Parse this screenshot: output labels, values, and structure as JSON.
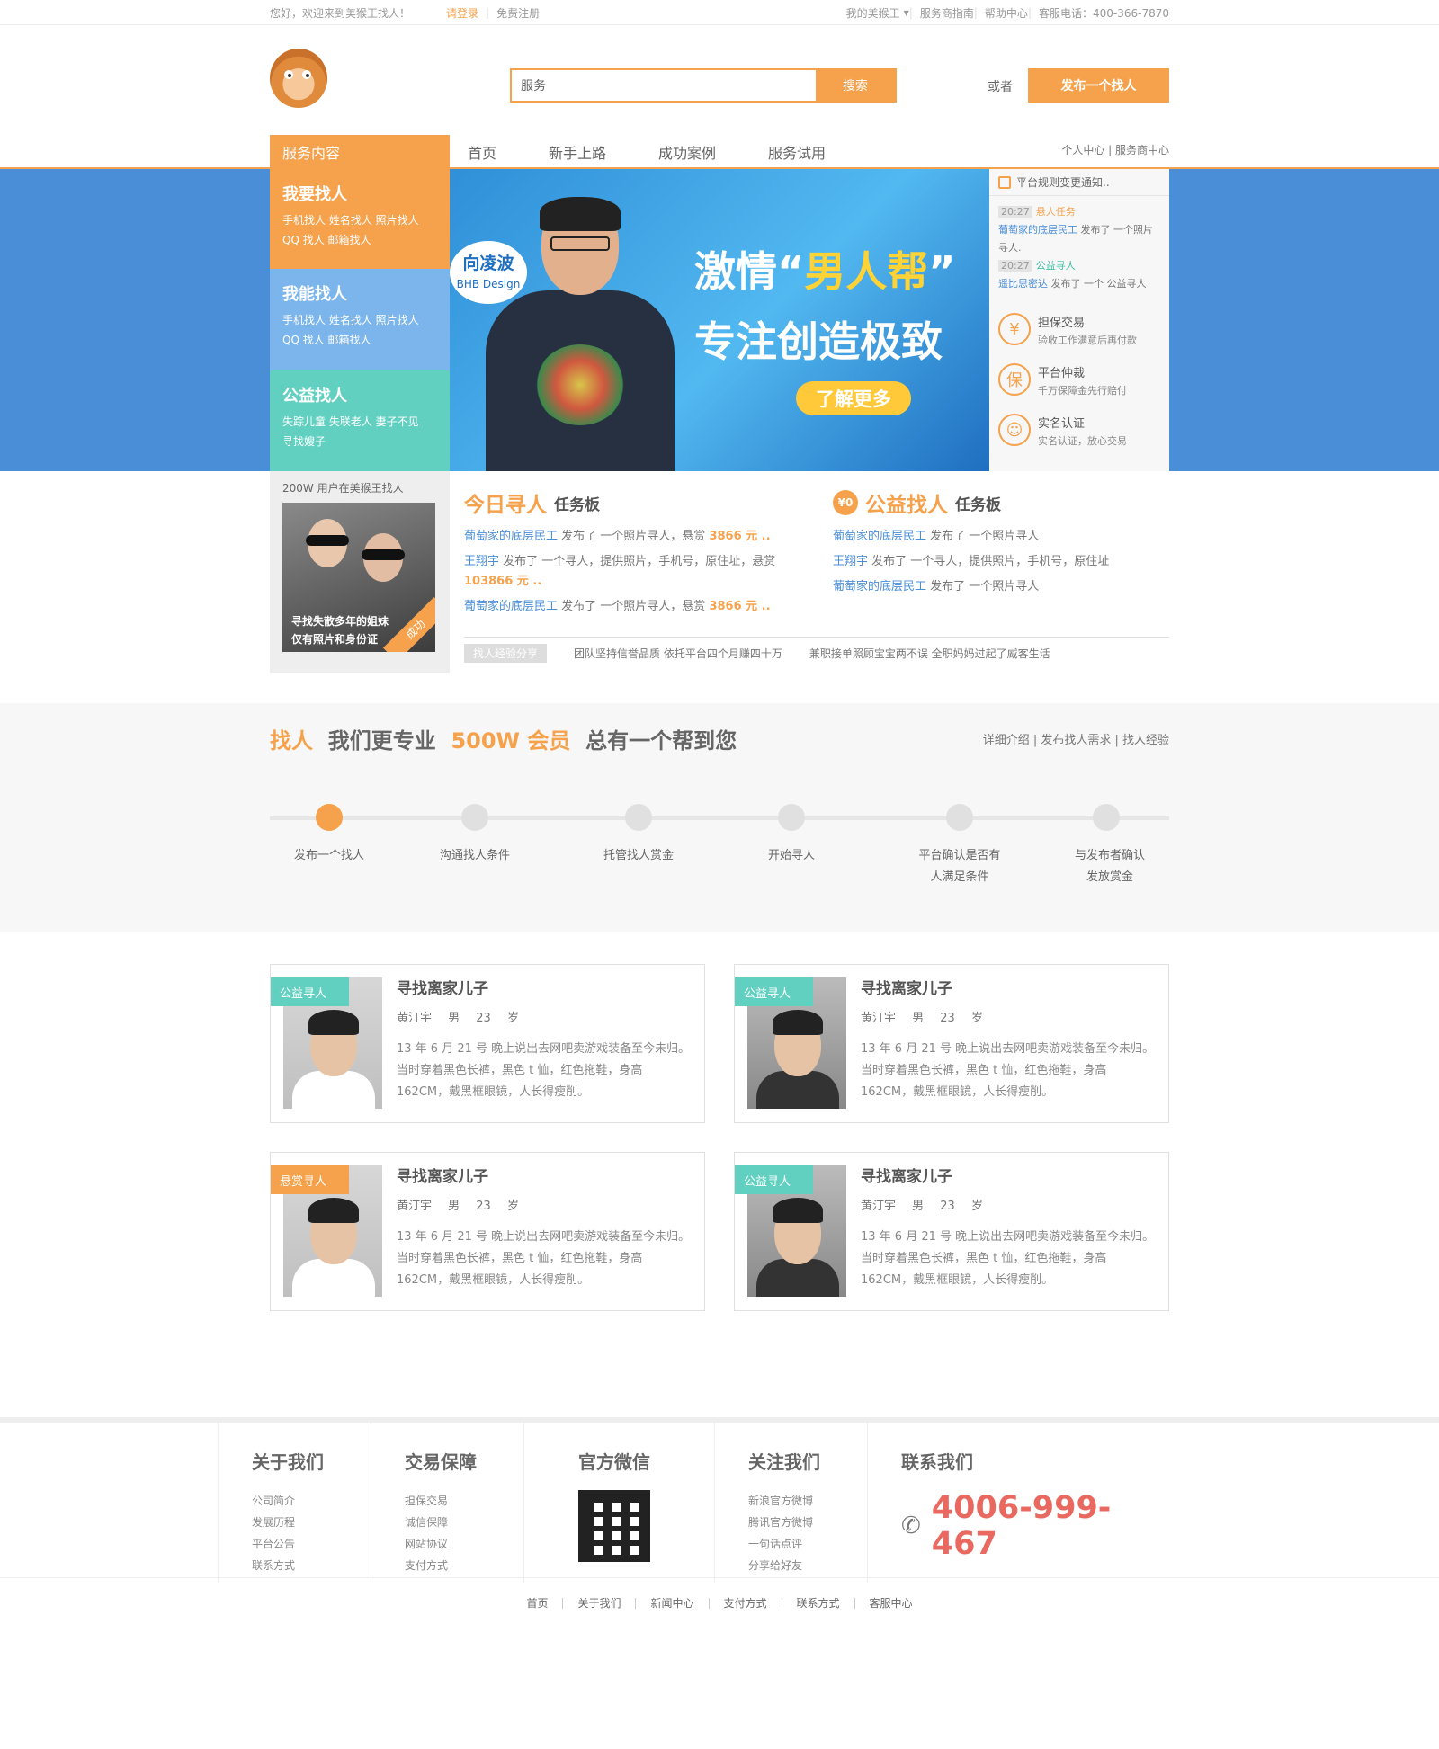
{
  "topbar": {
    "welcome": "您好，欢迎来到美猴王找人！",
    "login": "请登录",
    "register": "免费注册",
    "my_account": "我的美猴王",
    "guide": "服务商指南",
    "help": "帮助中心",
    "hotline": "客服电话：400-366-7870"
  },
  "header": {
    "logo": "monkey-logo",
    "search_value": "服务",
    "search_button": "搜索",
    "or": "或者",
    "post_button": "发布一个找人"
  },
  "nav": {
    "service_title": "服务内容",
    "items": [
      "首页",
      "新手上路",
      "成功案例",
      "服务试用"
    ],
    "right_links": "个人中心 | 服务商中心"
  },
  "sidebox": {
    "want": {
      "title": "我要找人",
      "line1": "手机找人   姓名找人   照片找人",
      "line2": "QQ 找人   邮箱找人"
    },
    "can": {
      "title": "我能找人",
      "line1": "手机找人   姓名找人   照片找人",
      "line2": "QQ 找人   邮箱找人"
    },
    "charity": {
      "title": "公益找人",
      "line1": "失踪儿童   失联老人   妻子不见",
      "line2": "寻找嫂子"
    }
  },
  "banner": {
    "bubble_name": "向凌波",
    "bubble_sub": "BHB Design",
    "slogan_pre": "激情“",
    "slogan_em": "男人帮",
    "slogan_post": "”",
    "slogan2": "专注创造极致",
    "learn_more": "了解更多"
  },
  "notice": {
    "title": "平台规则变更通知..",
    "feed": [
      {
        "time": "20:27",
        "type": "悬人任务",
        "user": "葡萄家的底层民工",
        "text": "发布了 一个照片寻人."
      },
      {
        "time": "20:27",
        "type": "公益寻人",
        "user": "遥比思密达",
        "text": "发布了 一个 公益寻人"
      }
    ],
    "guarantees": [
      {
        "icon": "¥",
        "title": "担保交易",
        "desc": "验收工作满意后再付款"
      },
      {
        "icon": "保",
        "title": "平台仲裁",
        "desc": "千万保障金先行赔付"
      },
      {
        "icon": "☺",
        "title": "实名认证",
        "desc": "实名认证，放心交易"
      }
    ]
  },
  "tasks": {
    "users_text": "200W 用户在美猴王找人",
    "photo_caption1": "寻找失散多年的姐妹",
    "photo_caption2": "仅有照片和身份证",
    "photo_ribbon": "成功",
    "today": {
      "title": "今日寻人",
      "sub": "任务板",
      "items": [
        {
          "user": "葡萄家的底层民工",
          "text": "发布了 一个照片寻人，悬赏",
          "amount": "3866 元 .."
        },
        {
          "user": "王翔宇",
          "text": "发布了 一个寻人，提供照片，手机号，原住址，悬赏",
          "amount": "103866 元 .."
        },
        {
          "user": "葡萄家的底层民工",
          "text": "发布了 一个照片寻人，悬赏",
          "amount": "3866 元 .."
        }
      ]
    },
    "charity": {
      "badge": "¥0",
      "title": "公益找人",
      "sub": "任务板",
      "items": [
        {
          "user": "葡萄家的底层民工",
          "text": "发布了 一个照片寻人"
        },
        {
          "user": "王翔宇",
          "text": "发布了 一个寻人，提供照片，手机号，原住址"
        },
        {
          "user": "葡萄家的底层民工",
          "text": "发布了 一个照片寻人"
        }
      ]
    },
    "share_tag": "找人经验分享",
    "share1": "团队坚持信誉品质 依托平台四个月赚四十万",
    "share2": "兼职接单照顾宝宝两不误 全职妈妈过起了威客生活"
  },
  "process": {
    "t1": "找人",
    "t2": "我们更专业",
    "t3": "500W 会员",
    "t4": "总有一个帮到您",
    "links": "详细介绍 | 发布找人需求 | 找人经验",
    "steps": [
      "发布一个找人",
      "沟通找人条件",
      "托管找人赏金",
      "开始寻人",
      "平台确认是否有\n人满足条件",
      "与发布者确认\n发放赏金"
    ]
  },
  "cards": [
    {
      "tag": "公益寻人",
      "tag_color": "#61d0c0",
      "title": "寻找离家儿子",
      "meta": "黄汀宇 男 23 岁",
      "desc": "13 年 6 月 21 号 晚上说出去网吧卖游戏装备至今未归。当时穿着黑色长裤，黑色 t 恤，红色拖鞋，身高162CM，戴黑框眼镜，人长得瘦削。"
    },
    {
      "tag": "公益寻人",
      "tag_color": "#61d0c0",
      "title": "寻找离家儿子",
      "meta": "黄汀宇 男 23 岁",
      "desc": "13 年 6 月 21 号 晚上说出去网吧卖游戏装备至今未归。当时穿着黑色长裤，黑色 t 恤，红色拖鞋，身高162CM，戴黑框眼镜，人长得瘦削。"
    },
    {
      "tag": "悬赏寻人",
      "tag_color": "#f6a24c",
      "title": "寻找离家儿子",
      "meta": "黄汀宇 男 23 岁",
      "desc": "13 年 6 月 21 号 晚上说出去网吧卖游戏装备至今未归。当时穿着黑色长裤，黑色 t 恤，红色拖鞋，身高162CM，戴黑框眼镜，人长得瘦削。"
    },
    {
      "tag": "公益寻人",
      "tag_color": "#61d0c0",
      "title": "寻找离家儿子",
      "meta": "黄汀宇 男 23 岁",
      "desc": "13 年 6 月 21 号 晚上说出去网吧卖游戏装备至今未归。当时穿着黑色长裤，黑色 t 恤，红色拖鞋，身高162CM，戴黑框眼镜，人长得瘦削。"
    }
  ],
  "footer": {
    "about": {
      "title": "关于我们",
      "links": [
        "公司简介",
        "发展历程",
        "平台公告",
        "联系方式"
      ]
    },
    "trade": {
      "title": "交易保障",
      "links": [
        "担保交易",
        "诚信保障",
        "网站协议",
        "支付方式"
      ]
    },
    "wechat": {
      "title": "官方微信"
    },
    "follow": {
      "title": "关注我们",
      "links": [
        "新浪官方微博",
        "腾讯官方微博",
        "一句话点评",
        "分享给好友"
      ]
    },
    "contact": {
      "title": "联系我们",
      "phone": "4006-999-467"
    },
    "bottom_links": [
      "首页",
      "关于我们",
      "新闻中心",
      "支付方式",
      "联系方式",
      "客服中心"
    ]
  }
}
